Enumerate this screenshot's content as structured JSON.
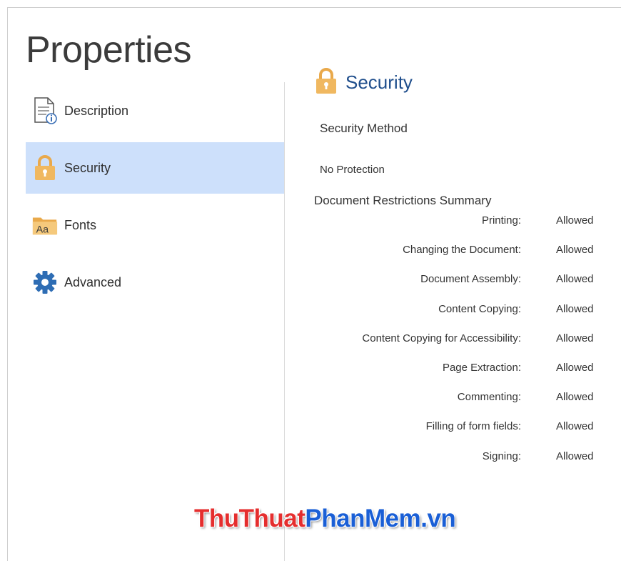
{
  "page": {
    "title": "Properties"
  },
  "sidebar": {
    "items": [
      {
        "label": "Description",
        "icon": "description-icon",
        "active": false
      },
      {
        "label": "Security",
        "icon": "lock-icon",
        "active": true
      },
      {
        "label": "Fonts",
        "icon": "fonts-folder-icon",
        "active": false
      },
      {
        "label": "Advanced",
        "icon": "gear-icon",
        "active": false
      }
    ]
  },
  "main": {
    "section_title": "Security",
    "security_method_label": "Security Method",
    "security_method_value": "No Protection",
    "restrictions_title": "Document Restrictions Summary",
    "restrictions": [
      {
        "name": "Printing:",
        "value": "Allowed"
      },
      {
        "name": "Changing the Document:",
        "value": "Allowed"
      },
      {
        "name": "Document Assembly:",
        "value": "Allowed"
      },
      {
        "name": "Content Copying:",
        "value": "Allowed"
      },
      {
        "name": "Content Copying for Accessibility:",
        "value": "Allowed"
      },
      {
        "name": "Page Extraction:",
        "value": "Allowed"
      },
      {
        "name": "Commenting:",
        "value": "Allowed"
      },
      {
        "name": "Filling of form fields:",
        "value": "Allowed"
      },
      {
        "name": "Signing:",
        "value": "Allowed"
      }
    ]
  },
  "watermark": {
    "part1": "ThuThuat",
    "part2": "PhanMem.vn"
  },
  "colors": {
    "accent": "#1f4e8c",
    "active_bg": "#cde0fb",
    "lock": "#f0b860",
    "gear": "#2e6db4"
  }
}
